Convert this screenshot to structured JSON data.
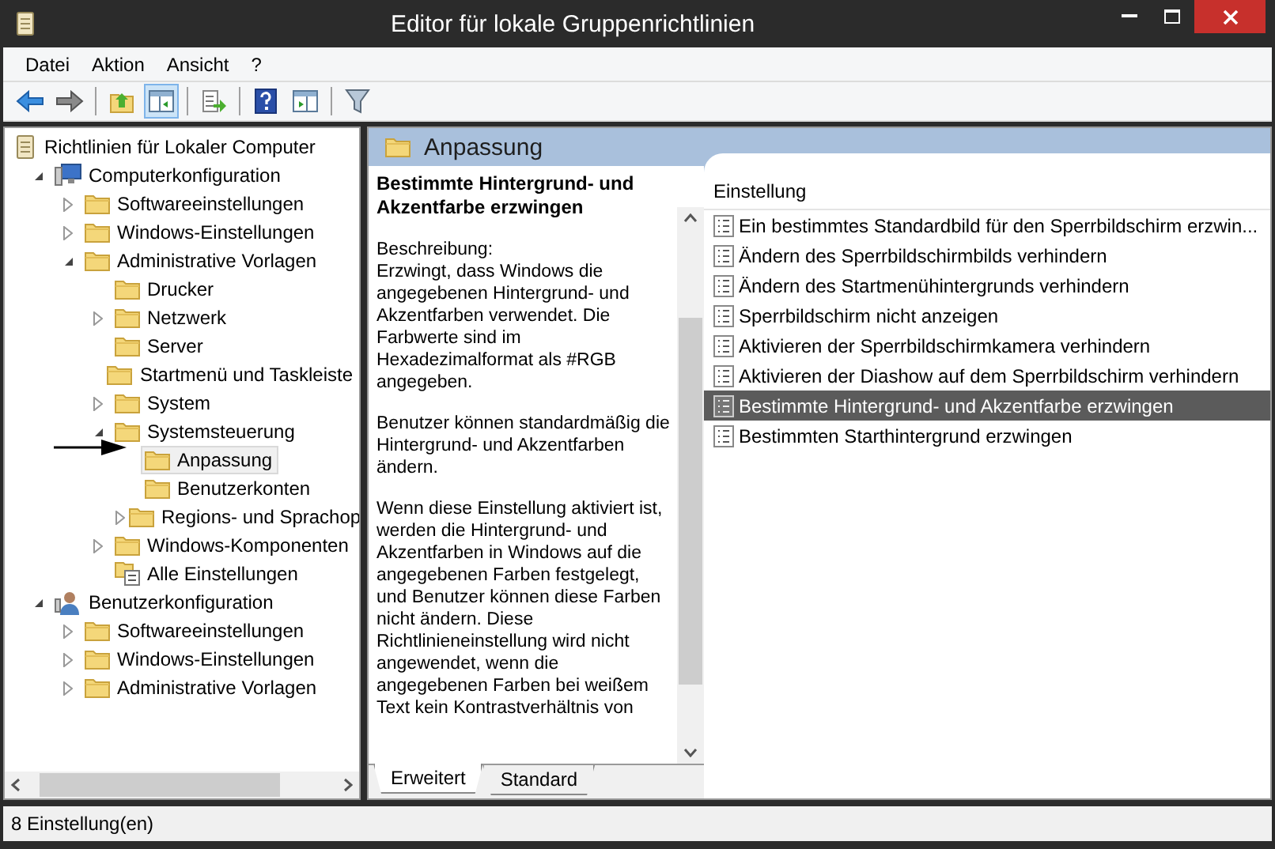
{
  "window": {
    "title": "Editor für lokale Gruppenrichtlinien"
  },
  "menu": [
    "Datei",
    "Aktion",
    "Ansicht",
    "?"
  ],
  "toolbar": [
    {
      "kind": "back",
      "pressed": false
    },
    {
      "kind": "forward",
      "pressed": false
    },
    {
      "kind": "sep"
    },
    {
      "kind": "up",
      "pressed": false
    },
    {
      "kind": "tree",
      "pressed": true
    },
    {
      "kind": "sep"
    },
    {
      "kind": "export",
      "pressed": false
    },
    {
      "kind": "sep"
    },
    {
      "kind": "help",
      "pressed": false
    },
    {
      "kind": "action",
      "pressed": false
    },
    {
      "kind": "sep"
    },
    {
      "kind": "filter",
      "pressed": false
    }
  ],
  "tree": [
    {
      "label": "Richtlinien für Lokaler Computer",
      "kind": "policy",
      "selected": false,
      "children": [
        {
          "label": "Computerkonfiguration",
          "kind": "computer",
          "selected": false,
          "expanded": true,
          "children": [
            {
              "label": "Softwareeinstellungen",
              "kind": "folder",
              "selected": false,
              "expanded": false
            },
            {
              "label": "Windows-Einstellungen",
              "kind": "folder",
              "selected": false,
              "expanded": false
            },
            {
              "label": "Administrative Vorlagen",
              "kind": "folder",
              "selected": false,
              "expanded": true,
              "children": [
                {
                  "label": "Drucker",
                  "kind": "folder",
                  "selected": false
                },
                {
                  "label": "Netzwerk",
                  "kind": "folder",
                  "selected": false,
                  "expanded": false
                },
                {
                  "label": "Server",
                  "kind": "folder",
                  "selected": false
                },
                {
                  "label": "Startmenü und Taskleiste",
                  "kind": "folder",
                  "selected": false
                },
                {
                  "label": "System",
                  "kind": "folder",
                  "selected": false,
                  "expanded": false
                },
                {
                  "label": "Systemsteuerung",
                  "kind": "folder",
                  "selected": false,
                  "expanded": true,
                  "children": [
                    {
                      "label": "Anpassung",
                      "kind": "folder",
                      "selected": true
                    },
                    {
                      "label": "Benutzerkonten",
                      "kind": "folder",
                      "selected": false
                    },
                    {
                      "label": "Regions- und Sprachop",
                      "kind": "folder",
                      "selected": false,
                      "expanded": false
                    }
                  ]
                },
                {
                  "label": "Windows-Komponenten",
                  "kind": "folder",
                  "selected": false,
                  "expanded": false
                },
                {
                  "label": "Alle Einstellungen",
                  "kind": "all",
                  "selected": false
                }
              ]
            }
          ]
        },
        {
          "label": "Benutzerkonfiguration",
          "kind": "user",
          "selected": false,
          "expanded": true,
          "children": [
            {
              "label": "Softwareeinstellungen",
              "kind": "folder",
              "selected": false,
              "expanded": false
            },
            {
              "label": "Windows-Einstellungen",
              "kind": "folder",
              "selected": false,
              "expanded": false
            },
            {
              "label": "Administrative Vorlagen",
              "kind": "folder",
              "selected": false,
              "expanded": false
            }
          ]
        }
      ]
    }
  ],
  "header": {
    "title": "Anpassung"
  },
  "description": {
    "title": "Bestimmte Hintergrund- und Akzentfarbe erzwingen",
    "label": "Beschreibung:",
    "paragraphs": [
      "Erzwingt, dass Windows die angegebenen Hintergrund- und Akzentfarben verwendet. Die Farbwerte sind im Hexadezimalformat als #RGB angegeben.",
      "Benutzer können standardmäßig die Hintergrund- und Akzentfarben ändern.",
      "Wenn diese Einstellung aktiviert ist, werden die Hintergrund- und Akzentfarben in Windows auf die angegebenen Farben festgelegt, und Benutzer können diese Farben nicht ändern. Diese Richtlinieneinstellung wird nicht angewendet, wenn die angegebenen Farben bei weißem Text kein Kontrastverhältnis von"
    ]
  },
  "view_tabs": [
    {
      "label": "Erweitert",
      "selected": true
    },
    {
      "label": "Standard",
      "selected": false
    }
  ],
  "settings": {
    "column": "Einstellung",
    "rows": [
      {
        "label": "Ein bestimmtes Standardbild für den Sperrbildschirm erzwin...",
        "selected": false
      },
      {
        "label": "Ändern des Sperrbildschirmbilds verhindern",
        "selected": false
      },
      {
        "label": "Ändern des Startmenühintergrunds verhindern",
        "selected": false
      },
      {
        "label": "Sperrbildschirm nicht anzeigen",
        "selected": false
      },
      {
        "label": "Aktivieren der Sperrbildschirmkamera verhindern",
        "selected": false
      },
      {
        "label": "Aktivieren der Diashow auf dem Sperrbildschirm verhindern",
        "selected": false
      },
      {
        "label": "Bestimmte Hintergrund- und Akzentfarbe erzwingen",
        "selected": true
      },
      {
        "label": "Bestimmten Starthintergrund erzwingen",
        "selected": false
      }
    ]
  },
  "status_bar": "8 Einstellung(en)"
}
